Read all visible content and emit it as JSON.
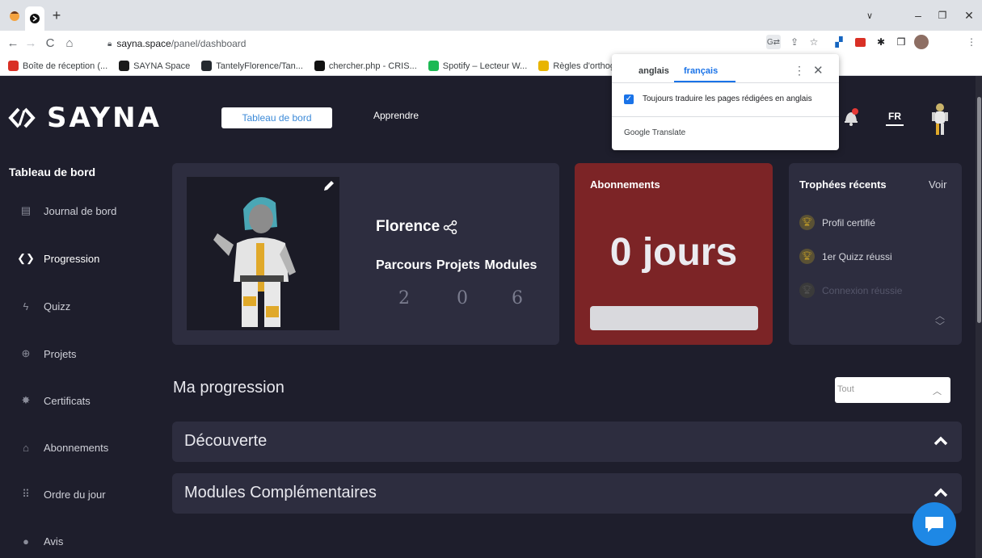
{
  "browser": {
    "url_host": "sayna.space",
    "url_path": "/panel/dashboard",
    "new_tab": "+",
    "bookmarks": [
      {
        "label": "Boîte de réception (...",
        "color": "#d93025"
      },
      {
        "label": "SAYNA Space",
        "color": "#1a1a1a"
      },
      {
        "label": "TantelyFlorence/Tan...",
        "color": "#24292f"
      },
      {
        "label": "chercher.php - CRIS...",
        "color": "#111111"
      },
      {
        "label": "Spotify – Lecteur W...",
        "color": "#1db954"
      },
      {
        "label": "Règles d'orthog",
        "color": "#e8b400"
      }
    ]
  },
  "translate_popup": {
    "source": "anglais",
    "target": "français",
    "always_label": "Toujours traduire les pages rédigées en anglais",
    "brand": "Google Translate"
  },
  "header": {
    "logo": "SAYNA",
    "nav_dashboard": "Tableau de bord",
    "nav_learn": "Apprendre",
    "lang": "FR"
  },
  "sidebar": {
    "title": "Tableau de bord",
    "items": [
      {
        "label": "Journal de bord",
        "icon": "journal-icon",
        "glyph": "▤",
        "active": false
      },
      {
        "label": "Progression",
        "icon": "sayna-logo-icon",
        "glyph": "❮❯",
        "active": true
      },
      {
        "label": "Quizz",
        "icon": "lightning-icon",
        "glyph": "ϟ",
        "active": false
      },
      {
        "label": "Projets",
        "icon": "target-icon",
        "glyph": "⊕",
        "active": false
      },
      {
        "label": "Certificats",
        "icon": "medal-icon",
        "glyph": "✸",
        "active": false
      },
      {
        "label": "Abonnements",
        "icon": "store-icon",
        "glyph": "⌂",
        "active": false
      },
      {
        "label": "Ordre du jour",
        "icon": "grid-icon",
        "glyph": "⠿",
        "active": false
      },
      {
        "label": "Avis",
        "icon": "info-icon",
        "glyph": "●",
        "active": false
      }
    ]
  },
  "profile": {
    "name": "Florence",
    "stats_labels": "Parcours Projets Modules",
    "parcours": "2",
    "projets": "0",
    "modules": "6"
  },
  "subscriptions": {
    "title": "Abonnements",
    "value": "0 jours"
  },
  "trophies": {
    "title": "Trophées récents",
    "see": "Voir",
    "items": [
      {
        "label": "Profil certifié",
        "dim": false
      },
      {
        "label": "1er Quizz réussi",
        "dim": false
      },
      {
        "label": "Connexion réussie",
        "dim": true
      }
    ]
  },
  "progression": {
    "title": "Ma progression",
    "filter": "Tout",
    "sections": [
      "Découverte",
      "Modules Complémentaires"
    ]
  },
  "colors": {
    "background": "#1e1e2c",
    "card": "#2d2d3f",
    "subscription_card": "#7c2426",
    "accent_blue": "#3c8ad8",
    "chat_button": "#1e88e5"
  }
}
